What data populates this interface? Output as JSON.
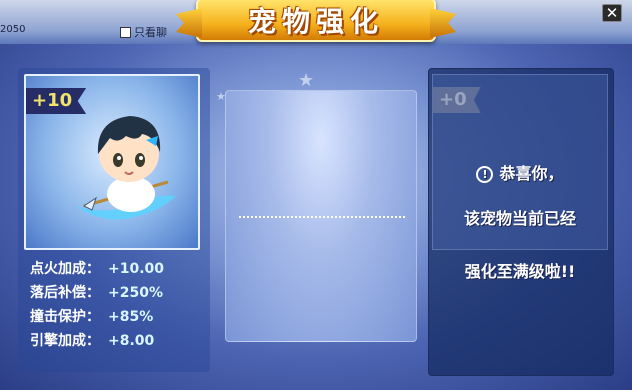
{
  "header": {
    "title": "宠物强化",
    "info_text": "2050",
    "checkbox_label": "只看聊",
    "close_symbol": "✕"
  },
  "pet": {
    "level_label": "+10",
    "stats": [
      {
        "label": "点火加成：",
        "value": "+10.00"
      },
      {
        "label": "落后补偿：",
        "value": "+250%"
      },
      {
        "label": "撞击保护：",
        "value": "+85%"
      },
      {
        "label": "引擎加成：",
        "value": "+8.00"
      }
    ]
  },
  "result": {
    "level_label": "+0",
    "message_line1": "恭喜你，",
    "message_line2": "该宠物当前已经",
    "message_line3": "强化至满级啦!!",
    "icon_symbol": "!"
  },
  "colors": {
    "title_gold": "#f6b21d",
    "stat_value": "#d9f6ff",
    "badge_active_text": "#f3e36b",
    "panel_dark": "#162c64"
  },
  "icons": [
    "close-icon",
    "warning-icon",
    "star-icon",
    "checkbox-icon"
  ]
}
